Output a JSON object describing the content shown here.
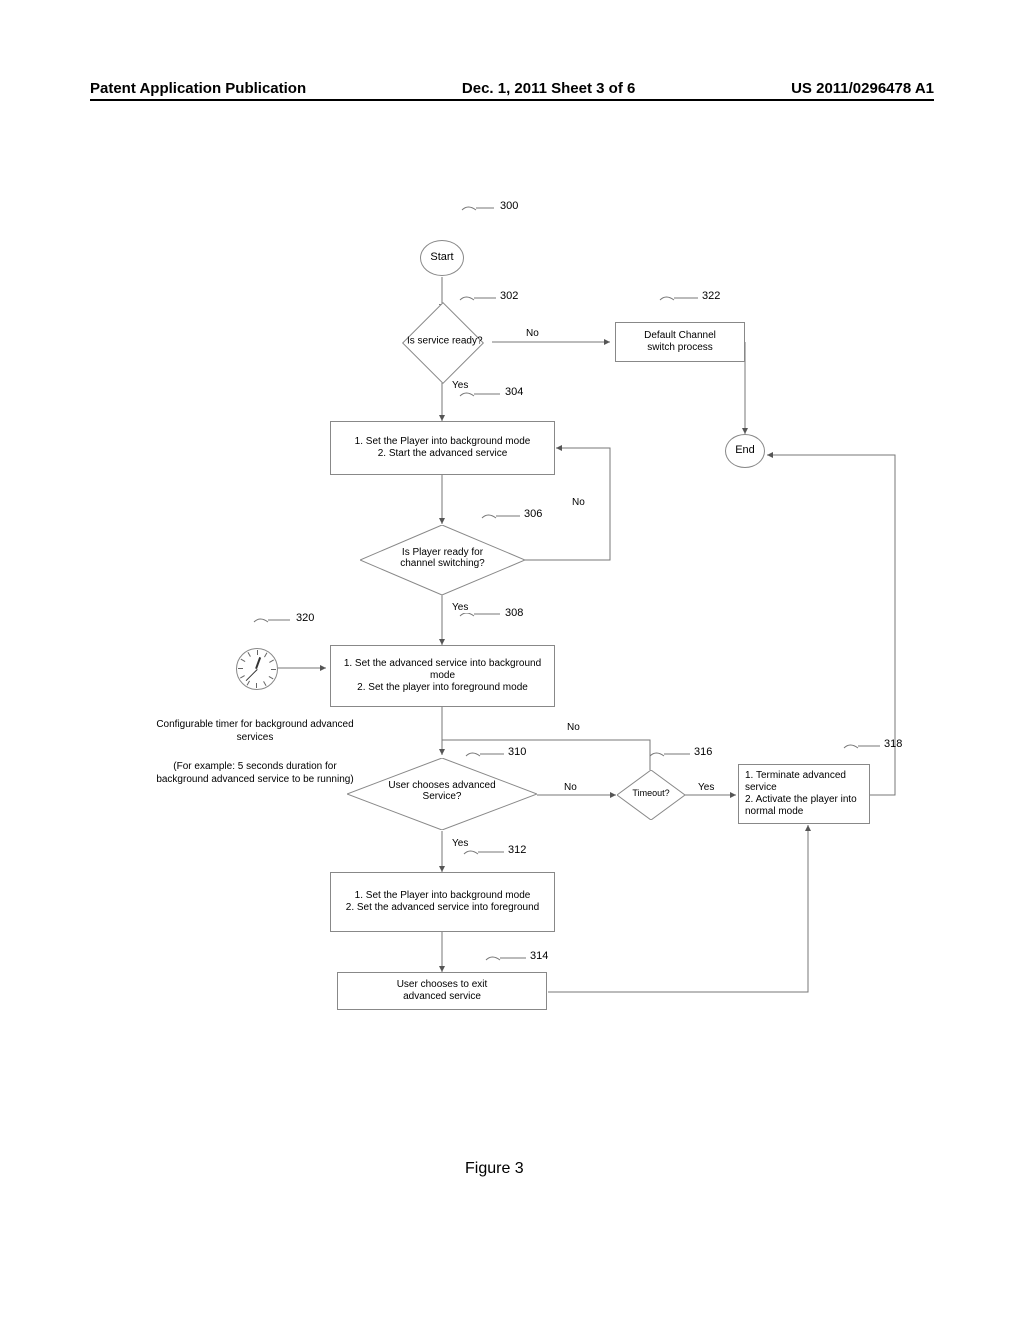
{
  "header": {
    "left": "Patent Application Publication",
    "center": "Dec. 1, 2011   Sheet 3 of 6",
    "right": "US 2011/0296478 A1"
  },
  "refs": {
    "r300": "300",
    "r302": "302",
    "r304": "304",
    "r306": "306",
    "r308": "308",
    "r310": "310",
    "r312": "312",
    "r314": "314",
    "r316": "316",
    "r318": "318",
    "r320": "320",
    "r322": "322"
  },
  "nodes": {
    "start": "Start",
    "end": "End",
    "d302": "Is service ready?",
    "b304_l1": "1. Set the Player into background mode",
    "b304_l2": "2. Start the advanced service",
    "d306": "Is Player ready for\nchannel switching?",
    "b308_l1": "1. Set the advanced service into background mode",
    "b308_l2": "2. Set the player into foreground mode",
    "d310": "User chooses advanced\nService?",
    "b312_l1": "1. Set the Player into background mode",
    "b312_l2": "2. Set the advanced service into foreground",
    "b314": "User chooses to exit\nadvanced service",
    "d316": "Timeout?",
    "b318_l1": "1. Terminate advanced service",
    "b318_l2": "2. Activate the player into normal mode",
    "b322": "Default Channel\nswitch process",
    "timer_caption_top": "Configurable timer for background advanced services",
    "timer_caption_bottom": "(For example: 5 seconds duration for background advanced service to be running)"
  },
  "labels": {
    "yes": "Yes",
    "no": "No"
  },
  "figure": "Figure 3"
}
